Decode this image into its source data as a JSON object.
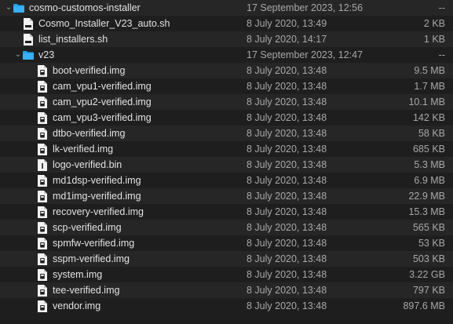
{
  "rows": [
    {
      "name": "cosmo-customos-installer",
      "date": "17 September 2023, 12:56",
      "size": "--",
      "icon": "folder-icon",
      "level": 0,
      "chevron": "down"
    },
    {
      "name": "Cosmo_Installer_V23_auto.sh",
      "date": "8 July 2020, 13:49",
      "size": "2 KB",
      "icon": "shell-script-icon",
      "level": 1
    },
    {
      "name": "list_installers.sh",
      "date": "8 July 2020, 14:17",
      "size": "1 KB",
      "icon": "shell-script-icon",
      "level": 1
    },
    {
      "name": "v23",
      "date": "17 September 2023, 12:47",
      "size": "--",
      "icon": "folder-icon",
      "level": 1,
      "chevron": "down"
    },
    {
      "name": "boot-verified.img",
      "date": "8 July 2020, 13:48",
      "size": "9.5 MB",
      "icon": "disk-image-icon",
      "level": 2
    },
    {
      "name": "cam_vpu1-verified.img",
      "date": "8 July 2020, 13:48",
      "size": "1.7 MB",
      "icon": "disk-image-icon",
      "level": 2
    },
    {
      "name": "cam_vpu2-verified.img",
      "date": "8 July 2020, 13:48",
      "size": "10.1 MB",
      "icon": "disk-image-icon",
      "level": 2
    },
    {
      "name": "cam_vpu3-verified.img",
      "date": "8 July 2020, 13:48",
      "size": "142 KB",
      "icon": "disk-image-icon",
      "level": 2
    },
    {
      "name": "dtbo-verified.img",
      "date": "8 July 2020, 13:48",
      "size": "58 KB",
      "icon": "disk-image-icon",
      "level": 2
    },
    {
      "name": "lk-verified.img",
      "date": "8 July 2020, 13:48",
      "size": "685 KB",
      "icon": "disk-image-icon",
      "level": 2
    },
    {
      "name": "logo-verified.bin",
      "date": "8 July 2020, 13:48",
      "size": "5.3 MB",
      "icon": "binary-file-icon",
      "level": 2
    },
    {
      "name": "md1dsp-verified.img",
      "date": "8 July 2020, 13:48",
      "size": "6.9 MB",
      "icon": "disk-image-icon",
      "level": 2
    },
    {
      "name": "md1img-verified.img",
      "date": "8 July 2020, 13:48",
      "size": "22.9 MB",
      "icon": "disk-image-icon",
      "level": 2
    },
    {
      "name": "recovery-verified.img",
      "date": "8 July 2020, 13:48",
      "size": "15.3 MB",
      "icon": "disk-image-icon",
      "level": 2
    },
    {
      "name": "scp-verified.img",
      "date": "8 July 2020, 13:48",
      "size": "565 KB",
      "icon": "disk-image-icon",
      "level": 2
    },
    {
      "name": "spmfw-verified.img",
      "date": "8 July 2020, 13:48",
      "size": "53 KB",
      "icon": "disk-image-icon",
      "level": 2
    },
    {
      "name": "sspm-verified.img",
      "date": "8 July 2020, 13:48",
      "size": "503 KB",
      "icon": "disk-image-icon",
      "level": 2
    },
    {
      "name": "system.img",
      "date": "8 July 2020, 13:48",
      "size": "3.22 GB",
      "icon": "disk-image-icon",
      "level": 2
    },
    {
      "name": "tee-verified.img",
      "date": "8 July 2020, 13:48",
      "size": "797 KB",
      "icon": "disk-image-icon",
      "level": 2
    },
    {
      "name": "vendor.img",
      "date": "8 July 2020, 13:48",
      "size": "897.6 MB",
      "icon": "disk-image-icon",
      "level": 2
    }
  ],
  "colors": {
    "background": "#1e1e1e",
    "alt_row": "#262626",
    "folder_blue": "#1ea1f2",
    "text_primary": "#e2e2e2",
    "text_secondary": "#a8a8a8"
  }
}
